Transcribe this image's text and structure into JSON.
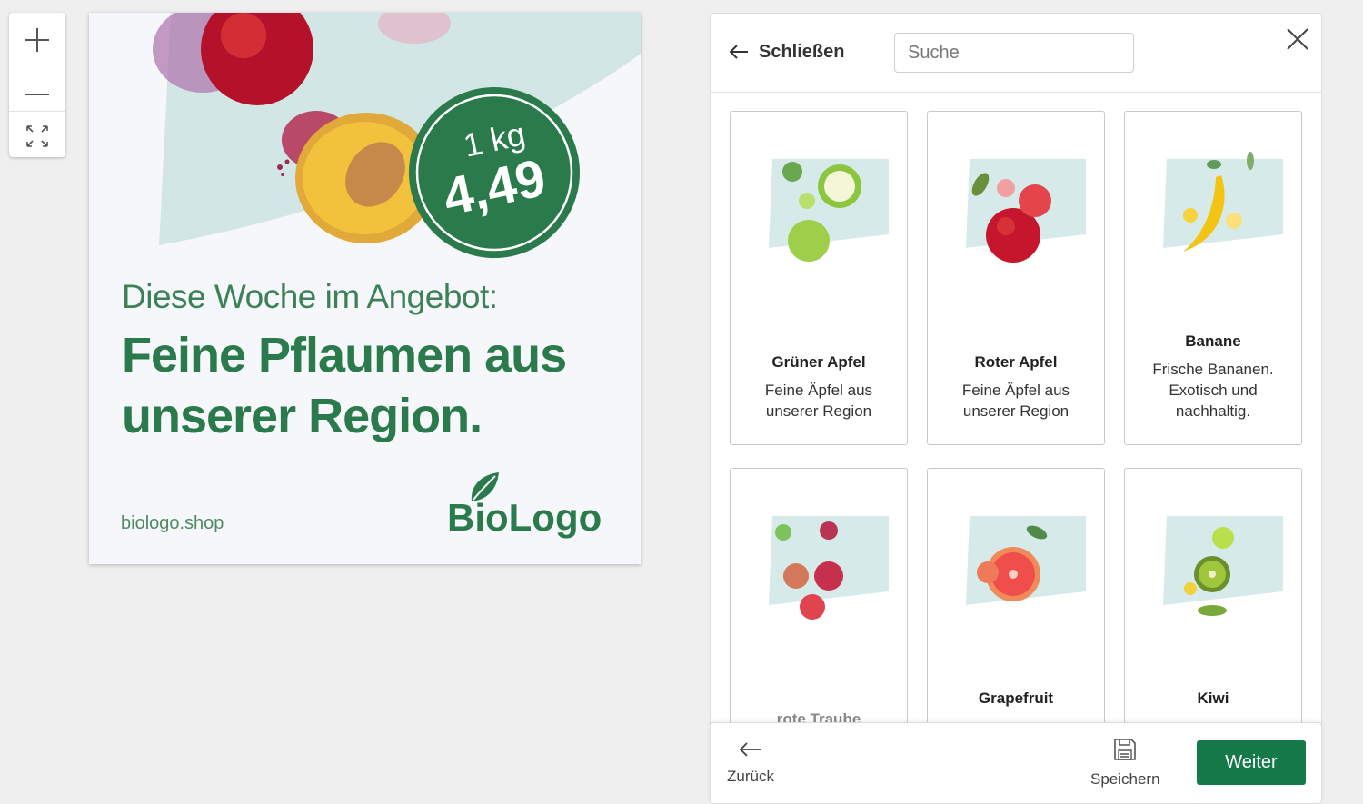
{
  "zoom": {
    "in_icon": "plus-icon",
    "out_icon": "minus-icon",
    "fit_icon": "expand-icon"
  },
  "ad": {
    "intro": "Diese Woche im Angebot:",
    "headline_line1": "Feine Pflaumen aus",
    "headline_line2": "unserer Region.",
    "url": "biologo.shop",
    "logo": "BioLogo",
    "badge_unit": "1 kg",
    "badge_price": "4,49",
    "brand_color": "#2a7a4c"
  },
  "header": {
    "close_label": "Schließen",
    "search_placeholder": "Suche"
  },
  "products": [
    {
      "title": "Grüner Apfel",
      "desc_line1": "Feine Äpfel aus",
      "desc_line2": "unserer Region",
      "desc_line3": ""
    },
    {
      "title": "Roter Apfel",
      "desc_line1": "Feine Äpfel aus",
      "desc_line2": "unserer Region",
      "desc_line3": ""
    },
    {
      "title": "Banane",
      "desc_line1": "Frische Bananen.",
      "desc_line2": "Exotisch und",
      "desc_line3": "nachhaltig."
    },
    {
      "title": "rote Traube",
      "desc_line1": "",
      "desc_line2": "",
      "desc_line3": ""
    },
    {
      "title": "Grapefruit",
      "desc_line1": "",
      "desc_line2": "",
      "desc_line3": ""
    },
    {
      "title": "Kiwi",
      "desc_line1": "",
      "desc_line2": "",
      "desc_line3": ""
    }
  ],
  "footer": {
    "back_label": "Zurück",
    "save_label": "Speichern",
    "next_label": "Weiter",
    "accent": "#16794a"
  }
}
